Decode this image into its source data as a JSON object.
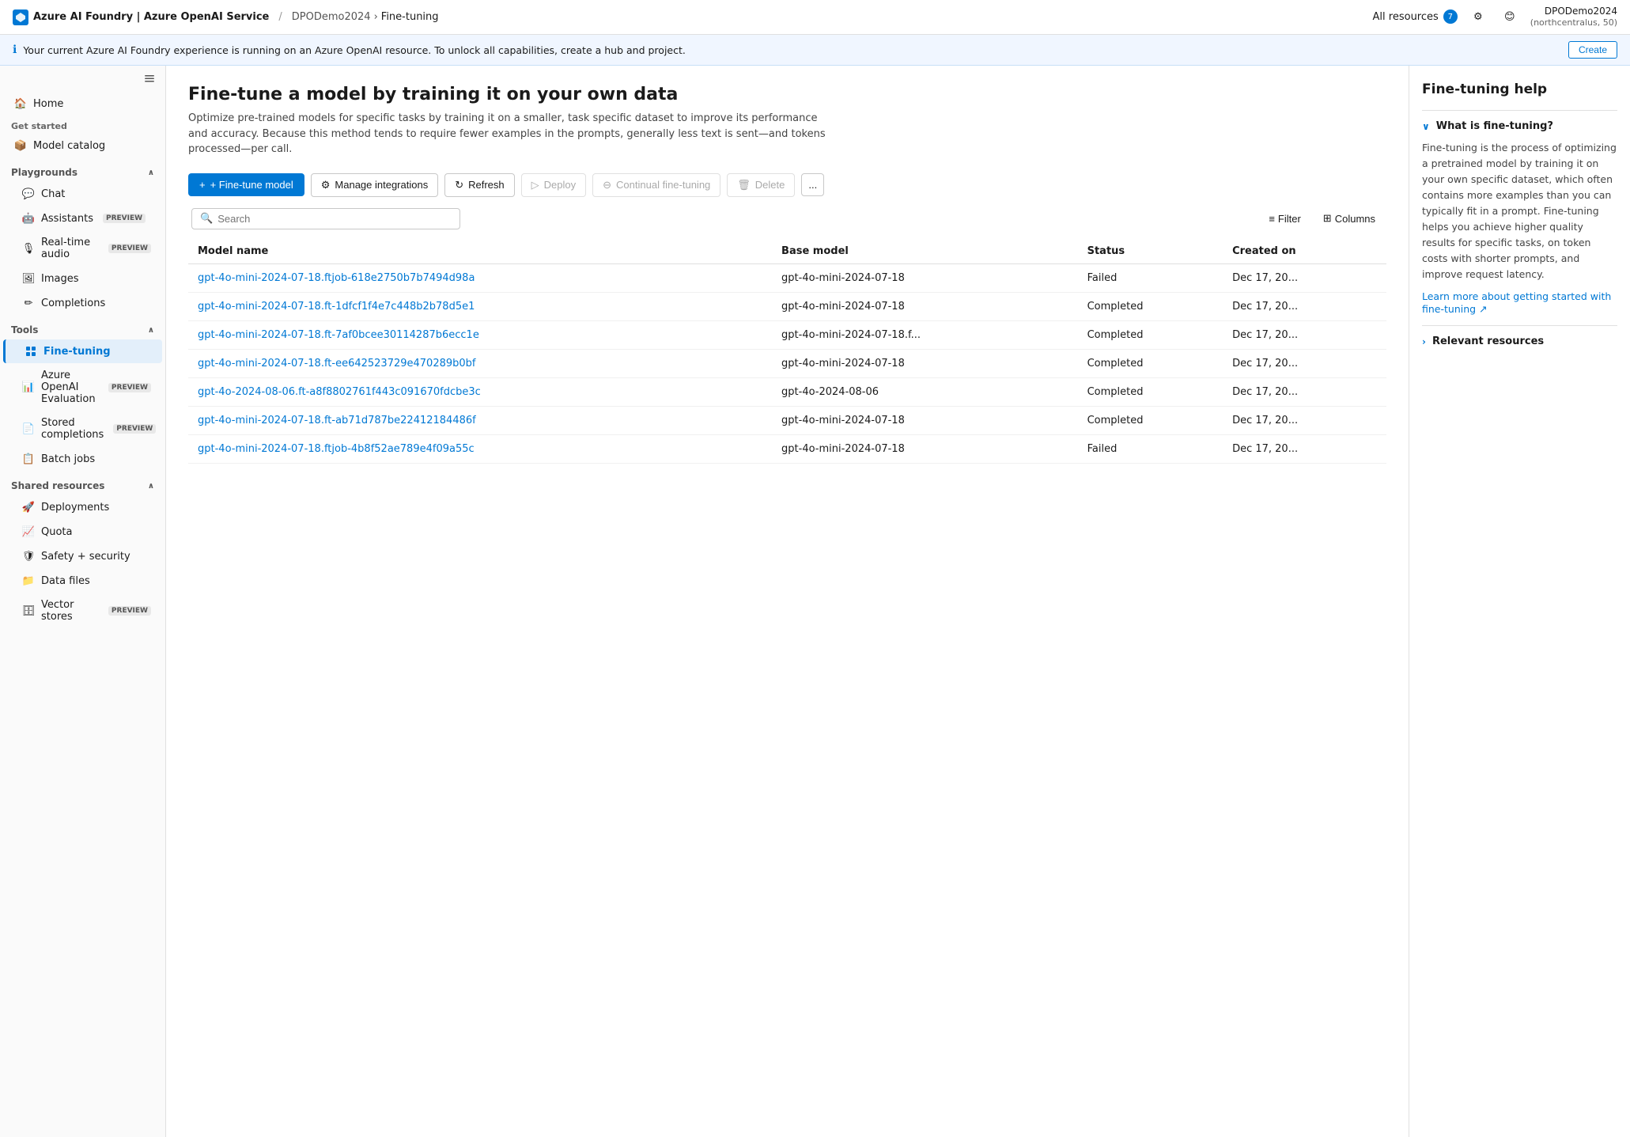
{
  "topbar": {
    "logo_text": "Azure AI Foundry | Azure OpenAI Service",
    "breadcrumb_1": "DPODemo2024",
    "breadcrumb_2": "Fine-tuning",
    "resources_label": "All resources",
    "resources_badge": "7",
    "user_name": "DPODemo2024",
    "user_location": "(northcentralus, 50)"
  },
  "banner": {
    "message": "Your current Azure AI Foundry experience is running on an Azure OpenAI resource. To unlock all capabilities, create a hub and project.",
    "create_label": "Create"
  },
  "sidebar": {
    "toggle_icon": "sidebar-toggle",
    "home_label": "Home",
    "get_started_label": "Get started",
    "model_catalog_label": "Model catalog",
    "playgrounds_label": "Playgrounds",
    "playgrounds_icon": "grid-icon",
    "chat_label": "Chat",
    "assistants_label": "Assistants",
    "assistants_badge": "PREVIEW",
    "realtime_audio_label": "Real-time audio",
    "realtime_audio_badge": "PREVIEW",
    "images_label": "Images",
    "completions_label": "Completions",
    "tools_label": "Tools",
    "fine_tuning_label": "Fine-tuning",
    "azure_openai_eval_label": "Azure OpenAI Evaluation",
    "azure_openai_eval_badge": "PREVIEW",
    "stored_completions_label": "Stored completions",
    "stored_completions_badge": "PREVIEW",
    "batch_jobs_label": "Batch jobs",
    "shared_resources_label": "Shared resources",
    "deployments_label": "Deployments",
    "quota_label": "Quota",
    "safety_security_label": "Safety + security",
    "data_files_label": "Data files",
    "vector_stores_label": "Vector stores",
    "vector_stores_badge": "PREVIEW"
  },
  "main": {
    "title": "Fine-tune a model by training it on your own data",
    "description": "Optimize pre-trained models for specific tasks by training it on a smaller, task specific dataset to improve its performance and accuracy. Because this method tends to require fewer examples in the prompts, generally less text is sent—and tokens processed—per call.",
    "toolbar": {
      "fine_tune_model": "+ Fine-tune model",
      "manage_integrations": "Manage integrations",
      "refresh": "Refresh",
      "deploy": "Deploy",
      "continual_fine_tuning": "Continual fine-tuning",
      "delete": "Delete",
      "more": "..."
    },
    "search_placeholder": "Search",
    "filter_label": "Filter",
    "columns_label": "Columns",
    "table": {
      "columns": [
        "Model name",
        "Base model",
        "Status",
        "Created on"
      ],
      "rows": [
        {
          "model_name": "gpt-4o-mini-2024-07-18.ftjob-618e2750b7b7494d98a",
          "base_model": "gpt-4o-mini-2024-07-18",
          "status": "Failed",
          "created_on": "Dec 17, 20..."
        },
        {
          "model_name": "gpt-4o-mini-2024-07-18.ft-1dfcf1f4e7c448b2b78d5e1",
          "base_model": "gpt-4o-mini-2024-07-18",
          "status": "Completed",
          "created_on": "Dec 17, 20..."
        },
        {
          "model_name": "gpt-4o-mini-2024-07-18.ft-7af0bcee30114287b6ecc1e",
          "base_model": "gpt-4o-mini-2024-07-18.f...",
          "status": "Completed",
          "created_on": "Dec 17, 20..."
        },
        {
          "model_name": "gpt-4o-mini-2024-07-18.ft-ee642523729e470289b0bf",
          "base_model": "gpt-4o-mini-2024-07-18",
          "status": "Completed",
          "created_on": "Dec 17, 20..."
        },
        {
          "model_name": "gpt-4o-2024-08-06.ft-a8f8802761f443c091670fdcbe3c",
          "base_model": "gpt-4o-2024-08-06",
          "status": "Completed",
          "created_on": "Dec 17, 20..."
        },
        {
          "model_name": "gpt-4o-mini-2024-07-18.ft-ab71d787be22412184486f",
          "base_model": "gpt-4o-mini-2024-07-18",
          "status": "Completed",
          "created_on": "Dec 17, 20..."
        },
        {
          "model_name": "gpt-4o-mini-2024-07-18.ftjob-4b8f52ae789e4f09a55c",
          "base_model": "gpt-4o-mini-2024-07-18",
          "status": "Failed",
          "created_on": "Dec 17, 20..."
        }
      ]
    }
  },
  "right_panel": {
    "title": "Fine-tuning help",
    "section1": {
      "label": "What is fine-tuning?",
      "text": "Fine-tuning is the process of optimizing a pretrained model by training it on your own specific dataset, which often contains more examples than you can typically fit in a prompt. Fine-tuning helps you achieve higher quality results for specific tasks, on token costs with shorter prompts, and improve request latency.",
      "link_text": "Learn more about getting started with fine-tuning ↗"
    },
    "section2": {
      "label": "Relevant resources"
    }
  }
}
